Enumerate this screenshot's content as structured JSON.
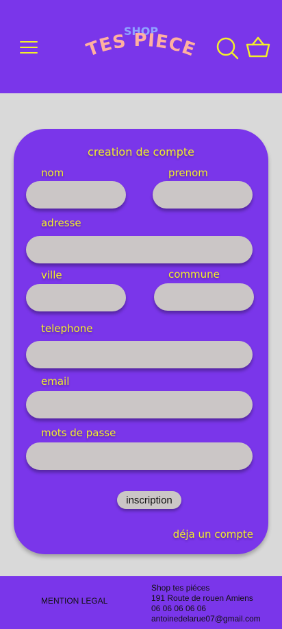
{
  "colors": {
    "primary": "#7a36ea",
    "accent": "#f3ef2a",
    "field": "#cbc6c6",
    "background": "#d9d9d9",
    "logo_top": "#8fa3ff",
    "logo_main": "#ffb0a0"
  },
  "header": {
    "menu_icon": "hamburger-menu-icon",
    "logo": {
      "top": "SHOP",
      "main": "TES PIECE"
    },
    "search_icon": "search-icon",
    "cart_icon": "basket-icon"
  },
  "form": {
    "title": "creation de compte",
    "fields": {
      "nom": {
        "label": "nom",
        "value": "",
        "placeholder": ""
      },
      "prenom": {
        "label": "prenom",
        "value": "",
        "placeholder": ""
      },
      "adresse": {
        "label": "adresse",
        "value": "",
        "placeholder": ""
      },
      "ville": {
        "label": "ville",
        "value": "",
        "placeholder": ""
      },
      "commune": {
        "label": "commune",
        "value": "",
        "placeholder": ""
      },
      "telephone": {
        "label": "telephone",
        "value": "",
        "placeholder": ""
      },
      "email": {
        "label": "email",
        "value": "",
        "placeholder": ""
      },
      "password": {
        "label": "mots de passe",
        "value": "",
        "placeholder": ""
      }
    },
    "submit_label": "inscription",
    "login_link": "déja un compte"
  },
  "footer": {
    "legal": "MENTION LEGAL",
    "contact": {
      "name": "Shop tes piéces",
      "address": "191 Route de rouen Amiens",
      "phone": "06 06 06 06 06",
      "email": "antoinedelarue07@gmail.com"
    }
  }
}
